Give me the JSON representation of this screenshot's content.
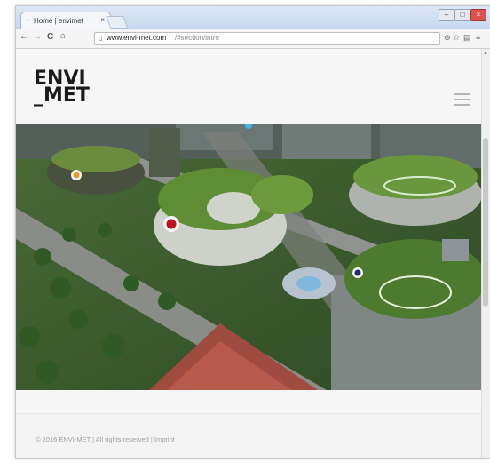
{
  "browser": {
    "tab_title": "Home | envimet",
    "tab_close": "×",
    "url_domain": "www.envi-met.com",
    "url_path": "/#section/intro",
    "nav": {
      "back": "←",
      "forward": "→",
      "reload": "C",
      "home": "⌂"
    },
    "window_controls": {
      "minimize": "–",
      "maximize": "□",
      "close": "×"
    }
  },
  "page": {
    "logo_line1": "ENVI",
    "logo_line2": "_MET",
    "footer_text": "© 2016 ENVI-MET | All rights reserved | Imprint"
  },
  "icons": [
    "tab-favicon-icon",
    "back-arrow-icon",
    "forward-arrow-icon",
    "reload-icon",
    "home-icon",
    "page-icon",
    "zoom-icon",
    "bookmark-star-icon",
    "page-menu-icon",
    "chrome-menu-icon",
    "hamburger-menu-icon"
  ],
  "colors": {
    "marker_orange": "#e69a2e",
    "marker_red": "#c1121f",
    "marker_navy": "#1f2a6b",
    "logo": "#1b1b1b"
  }
}
